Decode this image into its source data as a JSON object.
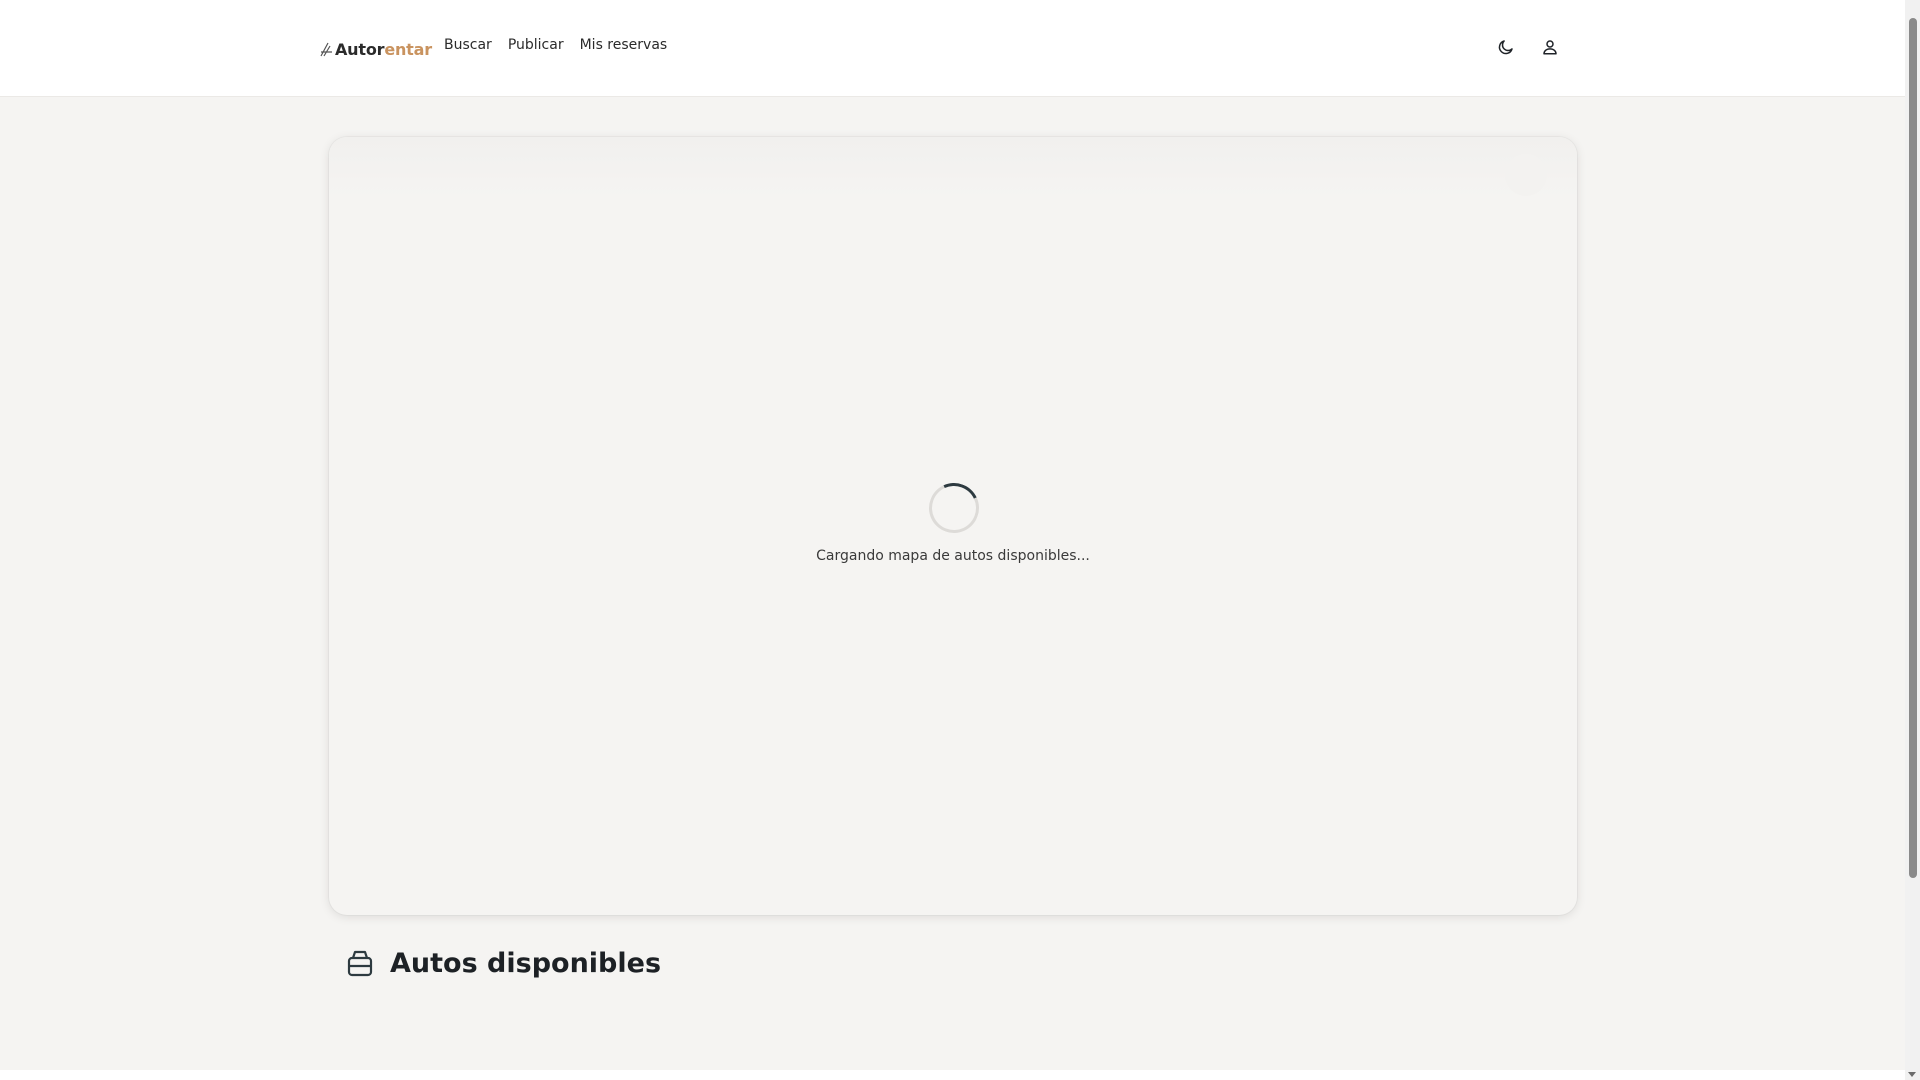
{
  "header": {
    "logo": {
      "part1": "Autor",
      "part2": "entar"
    },
    "nav": [
      {
        "label": "Buscar"
      },
      {
        "label": "Publicar"
      },
      {
        "label": "Mis reservas"
      }
    ],
    "icons": {
      "theme": "moon-icon",
      "account": "user-icon"
    }
  },
  "map": {
    "loading_text": "Cargando mapa de autos disponibles..."
  },
  "section": {
    "title": "Autos disponibles",
    "icon": "car-icon"
  },
  "colors": {
    "brand_accent": "#c9935f",
    "background": "#f5f4f2",
    "spinner": "#2d3a40"
  }
}
